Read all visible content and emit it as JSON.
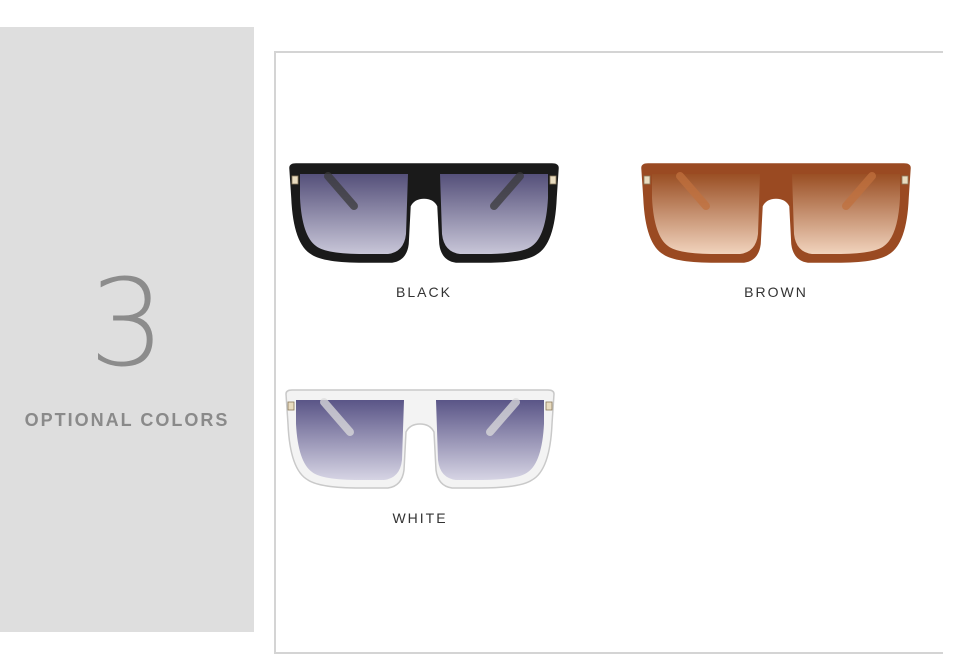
{
  "side_panel": {
    "count": "3",
    "caption": "OPTIONAL COLORS"
  },
  "products": [
    {
      "label": "BLACK",
      "frame_color": "#1a1a1a",
      "frame_shade": "#3a3a3a",
      "lens_top": "#55507a",
      "lens_bottom": "#c8c6d8"
    },
    {
      "label": "BROWN",
      "frame_color": "#9a4a22",
      "frame_shade": "#c0703e",
      "lens_top": "#9a4f24",
      "lens_bottom": "#f1d3bd"
    },
    {
      "label": "WHITE",
      "frame_color": "#f3f3f3",
      "frame_shade": "#dcdcdc",
      "lens_top": "#5a5587",
      "lens_bottom": "#d6d4e4"
    }
  ],
  "colors": {
    "panel_bg": "#dedede",
    "panel_text": "#8a8a8a",
    "border": "#d4d4d4"
  }
}
